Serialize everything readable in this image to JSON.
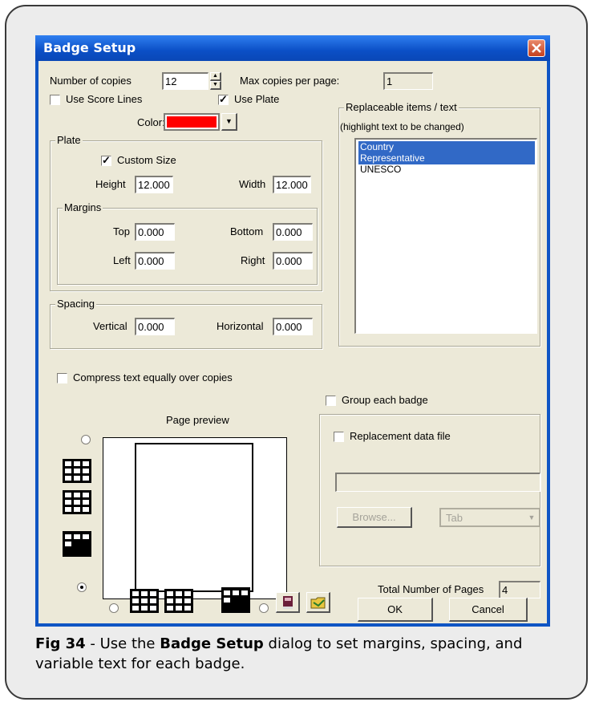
{
  "dialog": {
    "title": "Badge Setup",
    "number_of_copies_label": "Number of copies",
    "number_of_copies_value": "12",
    "max_copies_label": "Max copies per page:",
    "max_copies_value": "1",
    "use_score_lines_label": "Use Score Lines",
    "use_score_lines_checked": false,
    "use_plate_label": "Use Plate",
    "use_plate_checked": true,
    "color_label": "Color:",
    "color_value": "#ff0000",
    "replaceable_group_title": "Replaceable items / text",
    "replaceable_hint": "(highlight text to be changed)",
    "replaceable_items": [
      {
        "text": "Country",
        "selected": true
      },
      {
        "text": "Representative",
        "selected": true
      },
      {
        "text": "UNESCO",
        "selected": false
      }
    ],
    "plate": {
      "title": "Plate",
      "custom_size_label": "Custom Size",
      "custom_size_checked": true,
      "height_label": "Height",
      "height_value": "12.000",
      "width_label": "Width",
      "width_value": "12.000",
      "margins": {
        "title": "Margins",
        "top_label": "Top",
        "top_value": "0.000",
        "bottom_label": "Bottom",
        "bottom_value": "0.000",
        "left_label": "Left",
        "left_value": "0.000",
        "right_label": "Right",
        "right_value": "0.000"
      }
    },
    "spacing": {
      "title": "Spacing",
      "vertical_label": "Vertical",
      "vertical_value": "0.000",
      "horizontal_label": "Horizontal",
      "horizontal_value": "0.000"
    },
    "compress_label": "Compress text equally over copies",
    "group_each_badge_label": "Group each badge",
    "page_preview_label": "Page preview",
    "replacement_data_file_label": "Replacement data file",
    "replacement_data_file_value": "",
    "browse_label": "Browse...",
    "delimiter_value": "Tab",
    "total_pages_label": "Total Number of Pages",
    "total_pages_value": "4",
    "ok_label": "OK",
    "cancel_label": "Cancel"
  },
  "caption": {
    "prefix": "Fig 34",
    "text_before": " - Use the ",
    "bold": "Badge Setup",
    "text_after": " dialog to set margins, spacing, and variable text for each badge."
  },
  "colors": {
    "titlebar": "#0b4fc6",
    "dialog_bg": "#ece9d8",
    "selection": "#3169c6",
    "accent_red": "#ff0000"
  }
}
